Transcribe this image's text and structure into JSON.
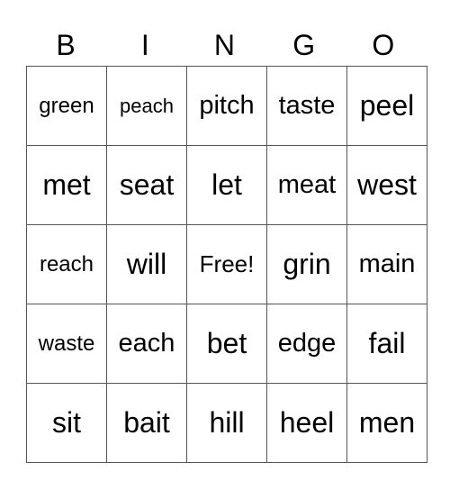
{
  "header": [
    "B",
    "I",
    "N",
    "G",
    "O"
  ],
  "rows": [
    [
      "green",
      "peach",
      "pitch",
      "taste",
      "peel"
    ],
    [
      "met",
      "seat",
      "let",
      "meat",
      "west"
    ],
    [
      "reach",
      "will",
      "Free!",
      "grin",
      "main"
    ],
    [
      "waste",
      "each",
      "bet",
      "edge",
      "fail"
    ],
    [
      "sit",
      "bait",
      "hill",
      "heel",
      "men"
    ]
  ]
}
